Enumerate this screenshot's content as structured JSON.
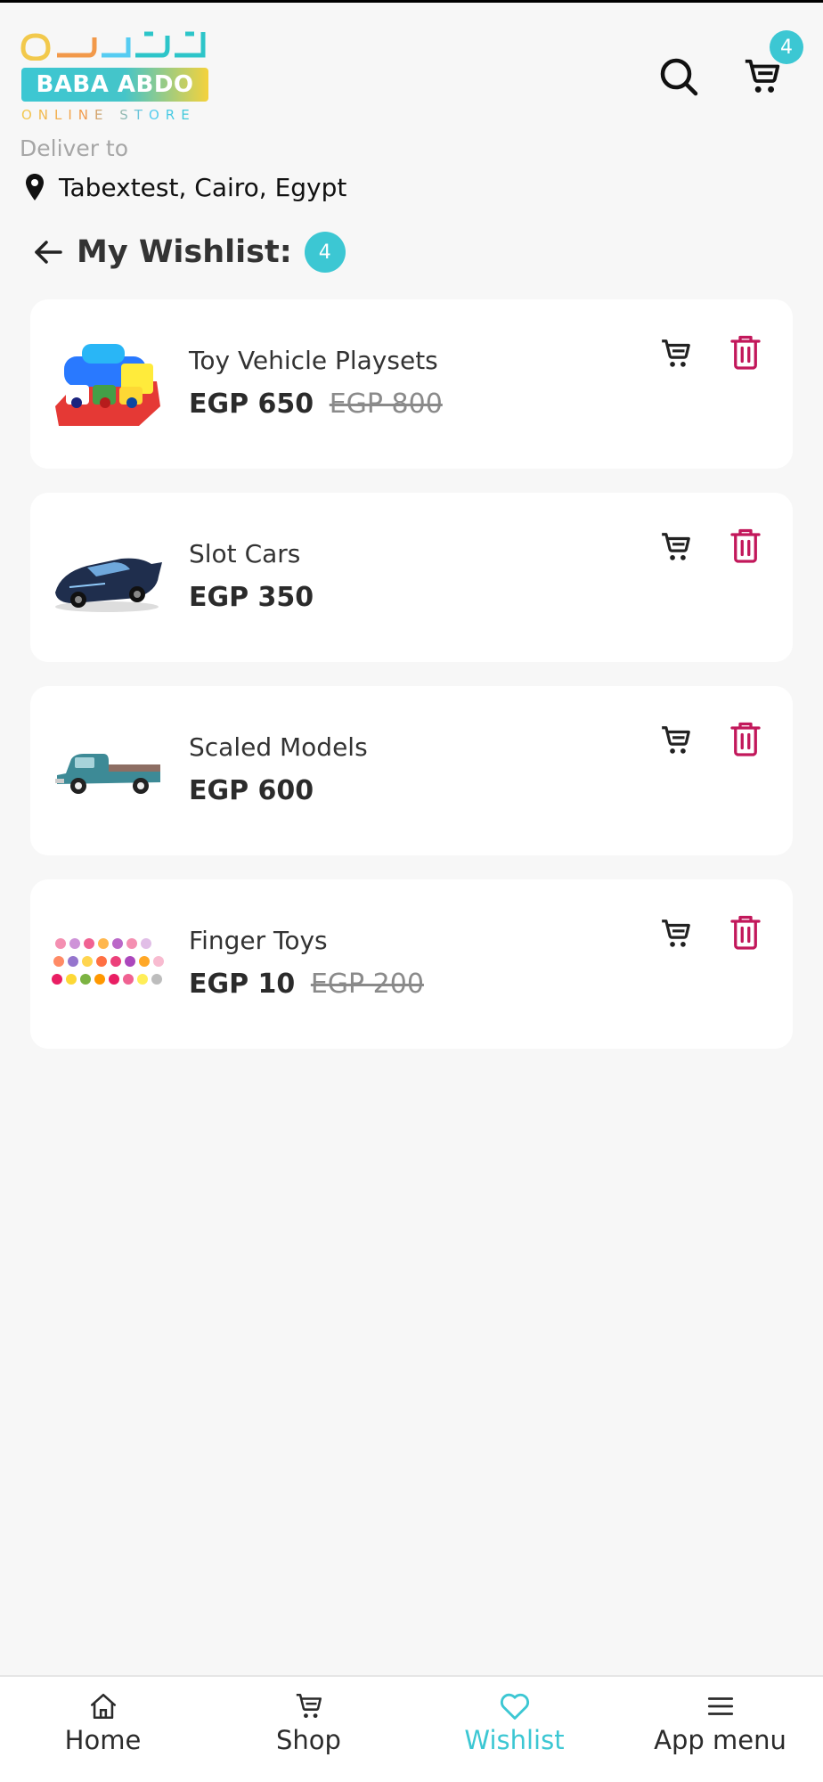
{
  "brand": {
    "arabic_name": "بابا عبده",
    "name": "BABA ABDO",
    "tagline": "ONLINE STORE"
  },
  "header": {
    "cart_count": "4",
    "deliver_label": "Deliver to",
    "location": "Tabextest, Cairo, Egypt"
  },
  "page": {
    "title": "My Wishlist:",
    "count": "4"
  },
  "items": [
    {
      "name": "Toy Vehicle Playsets",
      "price": "EGP 650",
      "old_price": "EGP 800"
    },
    {
      "name": "Slot Cars",
      "price": "EGP 350",
      "old_price": ""
    },
    {
      "name": "Scaled Models",
      "price": "EGP 600",
      "old_price": ""
    },
    {
      "name": "Finger Toys",
      "price": "EGP 10",
      "old_price": "EGP 200"
    }
  ],
  "nav": {
    "items": [
      {
        "label": "Home",
        "icon": "home-icon"
      },
      {
        "label": "Shop",
        "icon": "cart-icon"
      },
      {
        "label": "Wishlist",
        "icon": "heart-icon"
      },
      {
        "label": "App menu",
        "icon": "menu-icon"
      }
    ],
    "active": "Wishlist"
  },
  "colors": {
    "accent": "#3cc7d3",
    "delete": "#c2185b",
    "text": "#262626"
  }
}
